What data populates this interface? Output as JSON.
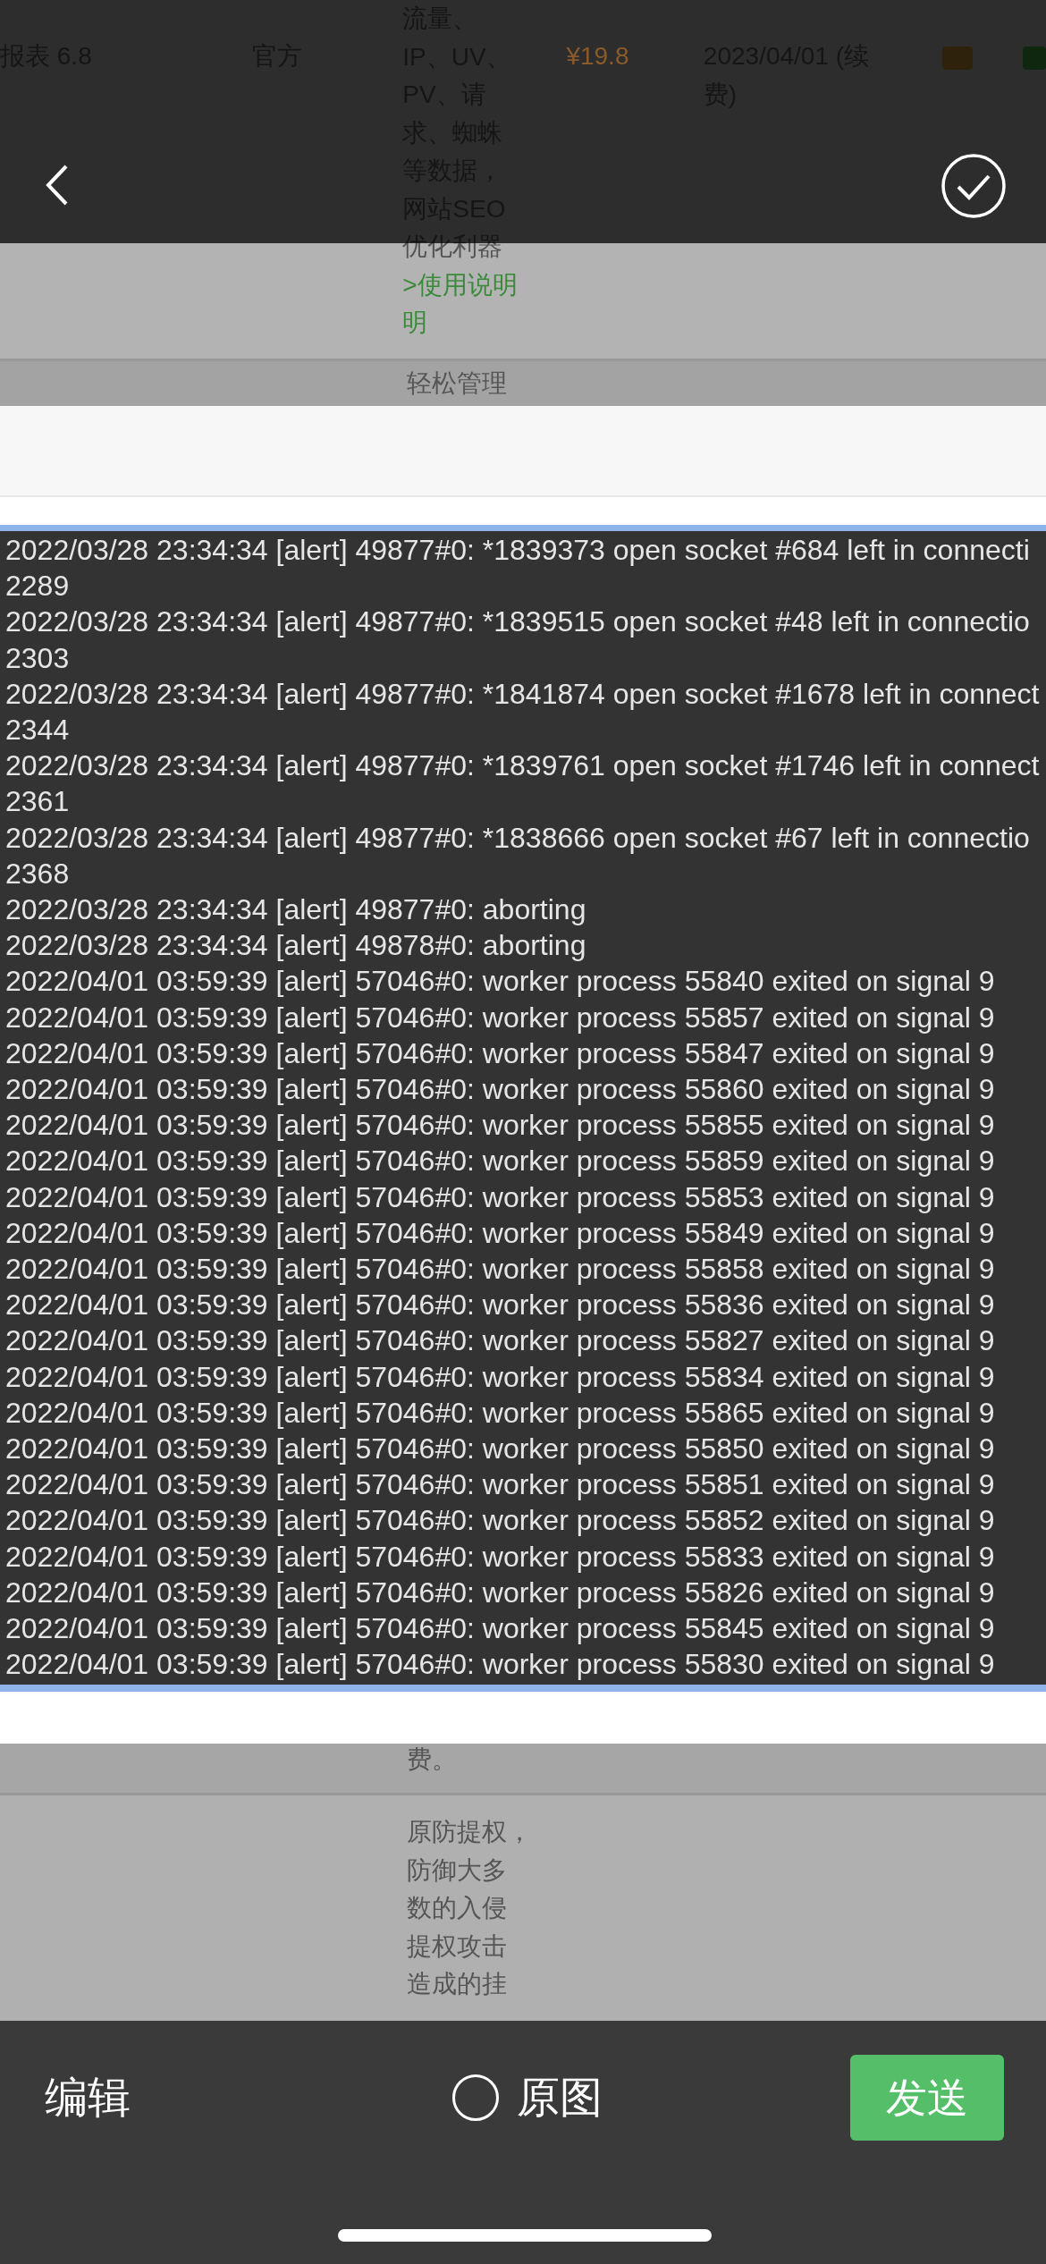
{
  "document_rows": [
    {
      "column_1": "报表 6.8",
      "column_2": "官方",
      "column_3": [
        "流量、",
        "IP、UV、",
        "PV、请",
        "求、蜘蛛",
        "等数据，",
        "网站SEO",
        "优化利器"
      ],
      "column_3_link": [
        ">使用说明",
        "明"
      ],
      "column_4": "¥19.8",
      "column_5": [
        "2023/04/01 (续",
        "费)"
      ]
    },
    {
      "column_3": [
        "轻松管理"
      ]
    }
  ],
  "log_image": {
    "lines": [
      "2022/03/28 23:34:34 [alert] 49877#0: *1839373 open socket #684 left in connecti",
      "2289",
      "2022/03/28 23:34:34 [alert] 49877#0: *1839515 open socket #48 left in connectio",
      "2303",
      "2022/03/28 23:34:34 [alert] 49877#0: *1841874 open socket #1678 left in connect",
      "2344",
      "2022/03/28 23:34:34 [alert] 49877#0: *1839761 open socket #1746 left in connect",
      "2361",
      "2022/03/28 23:34:34 [alert] 49877#0: *1838666 open socket #67 left in connectio",
      "2368",
      "2022/03/28 23:34:34 [alert] 49877#0: aborting",
      "2022/03/28 23:34:34 [alert] 49878#0: aborting",
      "2022/04/01 03:59:39 [alert] 57046#0: worker process 55840 exited on signal 9",
      "2022/04/01 03:59:39 [alert] 57046#0: worker process 55857 exited on signal 9",
      "2022/04/01 03:59:39 [alert] 57046#0: worker process 55847 exited on signal 9",
      "2022/04/01 03:59:39 [alert] 57046#0: worker process 55860 exited on signal 9",
      "2022/04/01 03:59:39 [alert] 57046#0: worker process 55855 exited on signal 9",
      "2022/04/01 03:59:39 [alert] 57046#0: worker process 55859 exited on signal 9",
      "2022/04/01 03:59:39 [alert] 57046#0: worker process 55853 exited on signal 9",
      "2022/04/01 03:59:39 [alert] 57046#0: worker process 55849 exited on signal 9",
      "2022/04/01 03:59:39 [alert] 57046#0: worker process 55858 exited on signal 9",
      "2022/04/01 03:59:39 [alert] 57046#0: worker process 55836 exited on signal 9",
      "2022/04/01 03:59:39 [alert] 57046#0: worker process 55827 exited on signal 9",
      "2022/04/01 03:59:39 [alert] 57046#0: worker process 55834 exited on signal 9",
      "2022/04/01 03:59:39 [alert] 57046#0: worker process 55865 exited on signal 9",
      "2022/04/01 03:59:39 [alert] 57046#0: worker process 55850 exited on signal 9",
      "2022/04/01 03:59:39 [alert] 57046#0: worker process 55851 exited on signal 9",
      "2022/04/01 03:59:39 [alert] 57046#0: worker process 55852 exited on signal 9",
      "2022/04/01 03:59:39 [alert] 57046#0: worker process 55833 exited on signal 9",
      "2022/04/01 03:59:39 [alert] 57046#0: worker process 55826 exited on signal 9",
      "2022/04/01 03:59:39 [alert] 57046#0: worker process 55845 exited on signal 9",
      "2022/04/01 03:59:39 [alert] 57046#0: worker process 55830 exited on signal 9"
    ]
  },
  "lower_rows": [
    {
      "column_3": [
        "费。"
      ]
    },
    {
      "column_3": [
        "原防提权，",
        "防御大多",
        "数的入侵",
        "提权攻击",
        "造成的挂"
      ]
    }
  ],
  "bottom_bar": {
    "edit": "编辑",
    "original_image": {
      "label": "原图",
      "checked": false
    },
    "send": "发送"
  }
}
